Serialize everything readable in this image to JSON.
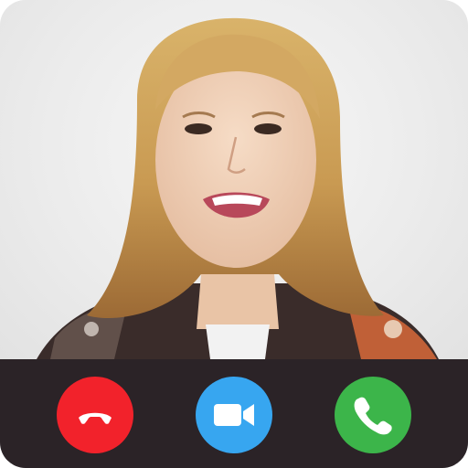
{
  "call_screen": {
    "background_color": "#ececec",
    "control_bar_color": "#2b2327"
  },
  "buttons": {
    "decline": {
      "icon": "phone-hangup-icon",
      "color": "#f2222b"
    },
    "video": {
      "icon": "video-camera-icon",
      "color": "#37a6f0"
    },
    "accept": {
      "icon": "phone-icon",
      "color": "#3cb54a"
    }
  }
}
